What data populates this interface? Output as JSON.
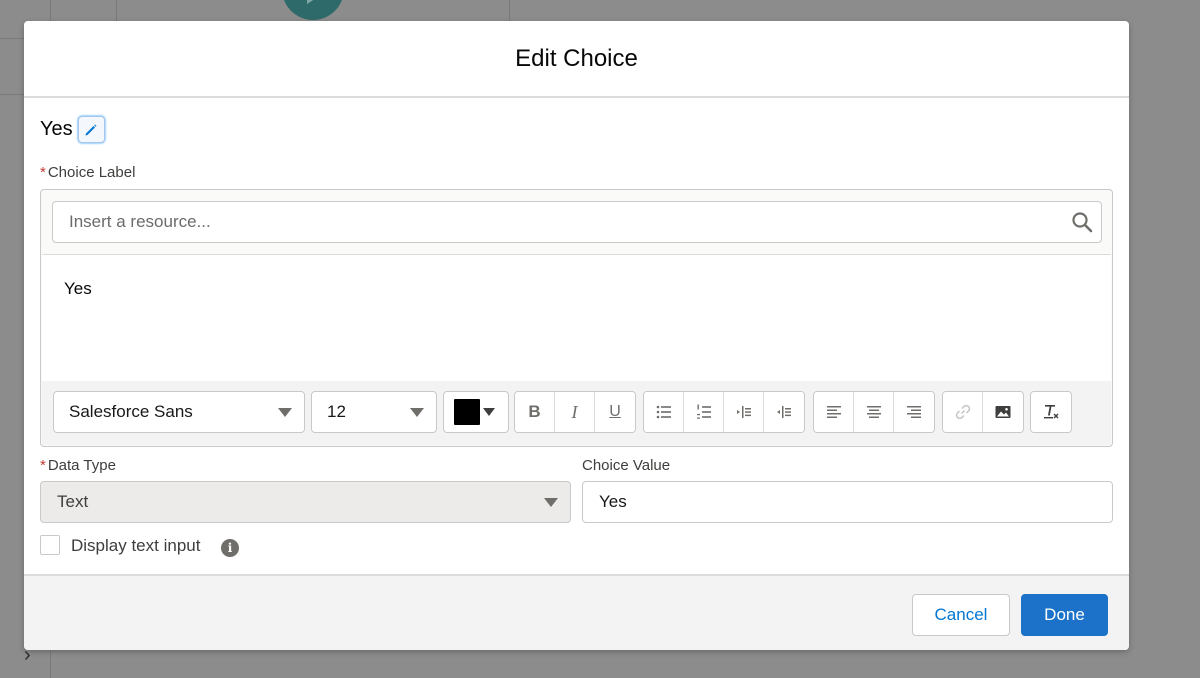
{
  "modal": {
    "title": "Edit Choice"
  },
  "choice": {
    "name": "Yes"
  },
  "choice_label": {
    "label": "Choice Label",
    "required_marker": "*",
    "search_placeholder": "Insert a resource...",
    "content": "Yes"
  },
  "toolbar": {
    "font_family": "Salesforce Sans",
    "font_size": "12",
    "text_color": "#000000",
    "buttons": {
      "bold": "B",
      "italic": "I",
      "underline": "U"
    }
  },
  "data_type": {
    "label": "Data Type",
    "required_marker": "*",
    "value": "Text"
  },
  "choice_value": {
    "label": "Choice Value",
    "value": "Yes"
  },
  "display_text_input": {
    "label": "Display text input",
    "checked": false,
    "info_glyph": "i"
  },
  "footer": {
    "cancel_label": "Cancel",
    "done_label": "Done"
  },
  "colors": {
    "brand": "#1b72c8",
    "required": "#c23934"
  }
}
